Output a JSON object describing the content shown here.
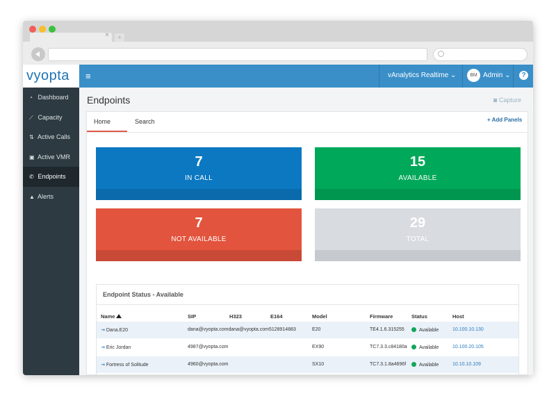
{
  "app": {
    "logo_text": "vyopta",
    "menu_icon": "hamburger-icon"
  },
  "header": {
    "view_selector": "vAnalytics Realtime",
    "avatar_initials": "BM",
    "user": "Admin",
    "help_label": "?"
  },
  "sidebar": {
    "items": [
      {
        "label": "Dashboard",
        "icon": "dashboard-icon"
      },
      {
        "label": "Capacity",
        "icon": "chart-icon"
      },
      {
        "label": "Active Calls",
        "icon": "calls-icon"
      },
      {
        "label": "Active VMR",
        "icon": "vmr-icon"
      },
      {
        "label": "Endpoints",
        "icon": "phone-icon",
        "active": true
      },
      {
        "label": "Alerts",
        "icon": "alert-icon"
      }
    ]
  },
  "page": {
    "title": "Endpoints",
    "capture_label": "Capture",
    "add_panels_label": "+ Add Panels"
  },
  "tabs": [
    {
      "label": "Home",
      "active": true
    },
    {
      "label": "Search"
    }
  ],
  "tiles": [
    {
      "value": "7",
      "label": "IN CALL",
      "color": "#0b78c1",
      "foot_color": "#0a6aab"
    },
    {
      "value": "15",
      "label": "AVAILABLE",
      "color": "#00a859",
      "foot_color": "#00964f"
    },
    {
      "value": "7",
      "label": "NOT AVAILABLE",
      "color": "#e2543d",
      "foot_color": "#c84a36"
    },
    {
      "value": "29",
      "label": "TOTAL",
      "color": "#d8dbe0",
      "foot_color": "#c6c9ce"
    }
  ],
  "endpoint_status": {
    "title": "Endpoint Status - Available",
    "columns": [
      "Name",
      "SIP",
      "H323",
      "E164",
      "Model",
      "Firmware",
      "Status",
      "Host"
    ],
    "rows": [
      {
        "name": "Dana.E20",
        "sip": "dana@vyopta.comdana@vyopta.com5128914883",
        "model": "E20",
        "firmware": "TE4.1.6.315255",
        "status": "Available",
        "host": "10.100.10.130"
      },
      {
        "name": "Eric Jordan",
        "sip": "4987@vyopta.com",
        "model": "EX90",
        "firmware": "TC7.3.3.c84180a",
        "status": "Available",
        "host": "10.100.20.105"
      },
      {
        "name": "Fortress of Solitude",
        "sip": "4960@vyopta.com",
        "model": "SX10",
        "firmware": "TC7.3.1.8a4696f",
        "status": "Available",
        "host": "10.10.10.109"
      }
    ]
  }
}
